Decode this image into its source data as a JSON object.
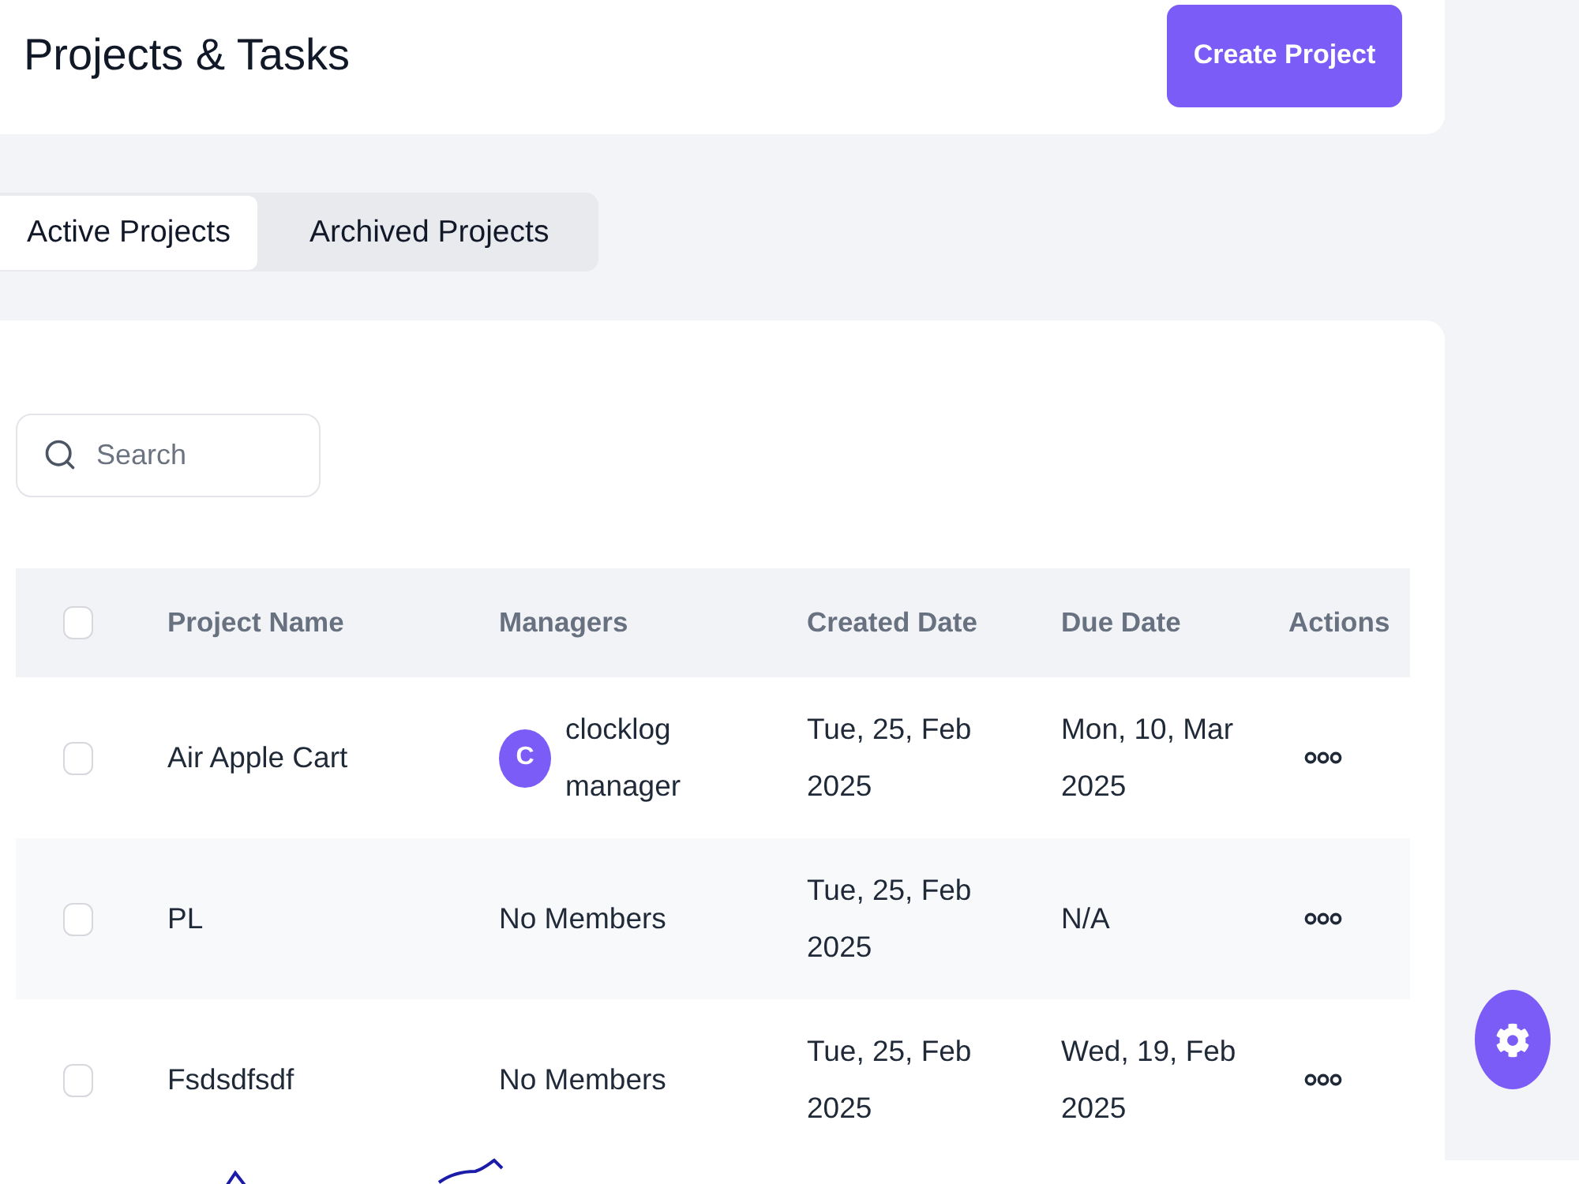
{
  "header": {
    "title": "Projects & Tasks",
    "create_button": "Create Project"
  },
  "tabs": [
    {
      "label": "Active Projects",
      "selected": true
    },
    {
      "label": "Archived Projects",
      "selected": false
    }
  ],
  "search": {
    "placeholder": "Search"
  },
  "table": {
    "select_all": {
      "checked": false
    },
    "columns": [
      "Project Name",
      "Managers",
      "Created Date",
      "Due Date",
      "Actions"
    ],
    "rows": [
      {
        "checked": false,
        "name": "Air Apple Cart",
        "managers": {
          "kind": "avatar",
          "initial": "C",
          "name": "clocklog manager"
        },
        "created": "Tue, 25, Feb 2025",
        "due": "Mon, 10, Mar 2025"
      },
      {
        "checked": false,
        "name": "PL",
        "managers": {
          "kind": "text",
          "text": "No Members"
        },
        "created": "Tue, 25, Feb 2025",
        "due": "N/A"
      },
      {
        "checked": false,
        "name": "Fsdsdfsdf",
        "managers": {
          "kind": "text",
          "text": "No Members"
        },
        "created": "Tue, 25, Feb 2025",
        "due": "Wed, 19, Feb 2025"
      }
    ]
  }
}
